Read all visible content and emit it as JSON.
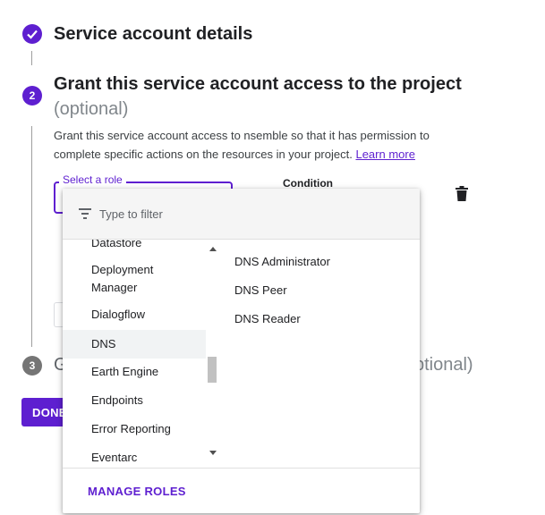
{
  "colors": {
    "accent": "#5e1fd0",
    "pending": "#757575"
  },
  "steps": [
    {
      "number": "",
      "title": "Service account details",
      "state": "done",
      "icon": "check-icon"
    },
    {
      "number": "2",
      "title": "Grant this service account access to the project",
      "optional": "(optional)",
      "state": "active"
    },
    {
      "number": "3",
      "title_visible_start": "G",
      "title_visible_end": "ptional)",
      "state": "pending"
    }
  ],
  "grant": {
    "description": "Grant this service account access to nsemble so that it has permission to complete specific actions on the resources in your project.",
    "learn_more": "Learn more",
    "role_label": "Select a role",
    "condition_label": "Condition"
  },
  "done_button": "DONE",
  "dropdown": {
    "filter_placeholder": "Type to filter",
    "services": [
      "Datastore",
      "Deployment Manager",
      "Dialogflow",
      "DNS",
      "Earth Engine",
      "Endpoints",
      "Error Reporting",
      "Eventarc"
    ],
    "selected_service": "DNS",
    "roles": [
      "DNS Administrator",
      "DNS Peer",
      "DNS Reader"
    ],
    "manage_roles": "MANAGE ROLES"
  }
}
